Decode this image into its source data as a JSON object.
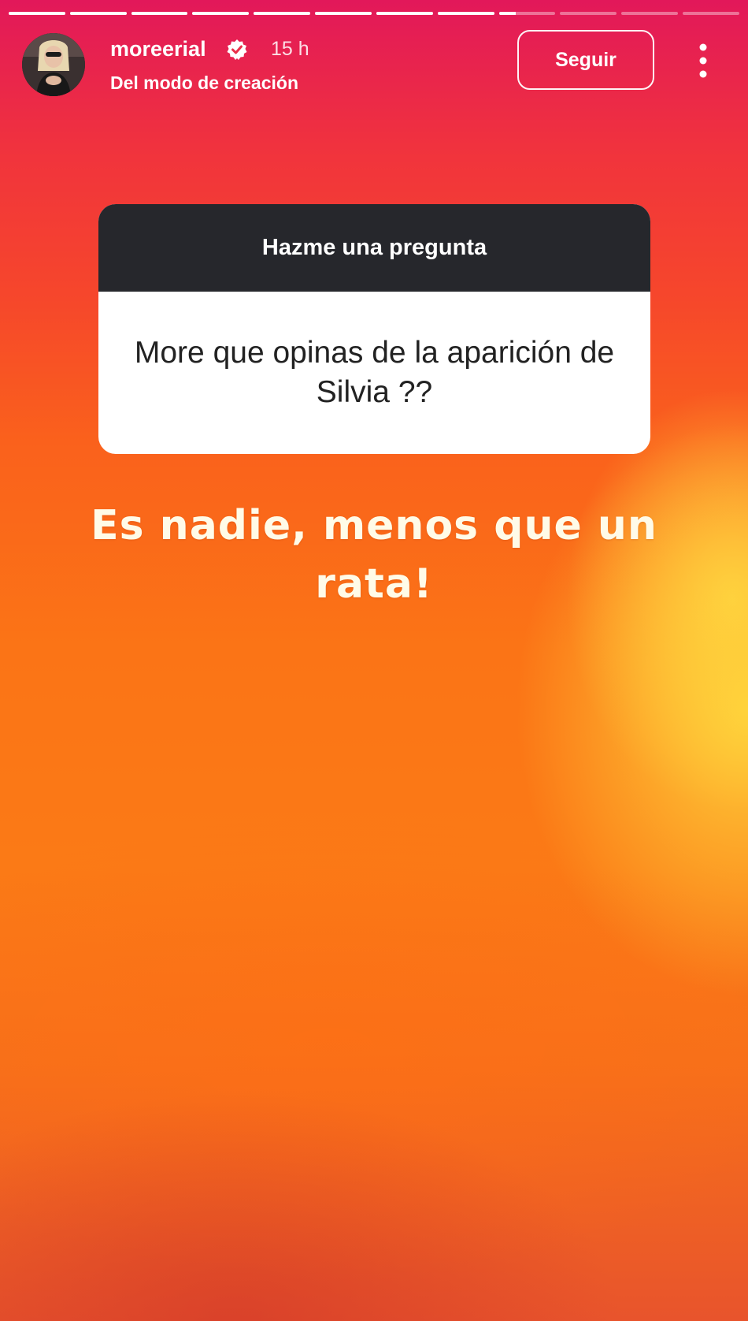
{
  "story": {
    "segments": [
      {
        "progress": 1
      },
      {
        "progress": 1
      },
      {
        "progress": 1
      },
      {
        "progress": 1
      },
      {
        "progress": 1
      },
      {
        "progress": 1
      },
      {
        "progress": 1
      },
      {
        "progress": 1
      },
      {
        "progress": 0.3
      },
      {
        "progress": 0
      },
      {
        "progress": 0
      },
      {
        "progress": 0
      }
    ]
  },
  "header": {
    "username": "moreerial",
    "verified": true,
    "time": "15 h",
    "subtitle": "Del modo de creación",
    "follow_label": "Seguir",
    "more_icon": "more-vertical-icon"
  },
  "question_sticker": {
    "title": "Hazme una pregunta",
    "question": "More que opinas de la aparición de Silvia ??"
  },
  "answer_text": "Es nadie, menos que un rata!",
  "colors": {
    "background_top": "#e2185a",
    "background_mid": "#fb7416",
    "background_glow": "#ffd63c",
    "sticker_header": "#26272c",
    "sticker_body": "#ffffff",
    "answer_text": "#fffbe8"
  }
}
